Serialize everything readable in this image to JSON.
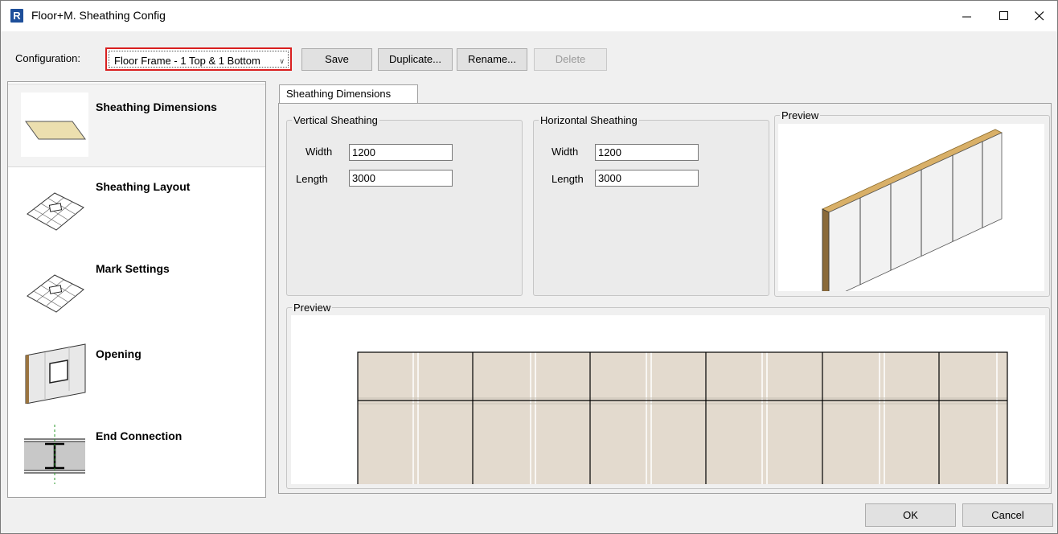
{
  "window": {
    "title": "Floor+M. Sheathing Config",
    "app_icon_letter": "R",
    "minimize_icon": "minimize-icon",
    "maximize_icon": "maximize-icon",
    "close_icon": "close-icon"
  },
  "toolbar": {
    "config_label": "Configuration:",
    "config_value": "Floor Frame - 1 Top & 1 Bottom",
    "save_label": "Save",
    "duplicate_label": "Duplicate...",
    "rename_label": "Rename...",
    "delete_label": "Delete",
    "highlight_color": "#d91f1f"
  },
  "sidebar": {
    "items": [
      {
        "label": "Sheathing Dimensions",
        "icon": "sheathing-panel-icon",
        "selected": true
      },
      {
        "label": "Sheathing Layout",
        "icon": "sheathing-layout-icon"
      },
      {
        "label": "Mark Settings",
        "icon": "mark-settings-icon"
      },
      {
        "label": "Opening",
        "icon": "opening-icon"
      },
      {
        "label": "End Connection",
        "icon": "end-connection-icon"
      }
    ]
  },
  "tabs": [
    {
      "label": "Sheathing Dimensions"
    }
  ],
  "vertical": {
    "title": "Vertical Sheathing",
    "width_label": "Width",
    "width_value": "1200",
    "length_label": "Length",
    "length_value": "3000"
  },
  "horizontal": {
    "title": "Horizontal Sheathing",
    "width_label": "Width",
    "width_value": "1200",
    "length_label": "Length",
    "length_value": "3000"
  },
  "preview_3d": {
    "title": "Preview"
  },
  "preview_2d": {
    "title": "Preview"
  },
  "footer": {
    "ok_label": "OK",
    "cancel_label": "Cancel"
  },
  "colors": {
    "sheathing_fill": "#e3dace",
    "sheathing_lines": "#ffffff",
    "board_edge": "#c9a24e"
  }
}
